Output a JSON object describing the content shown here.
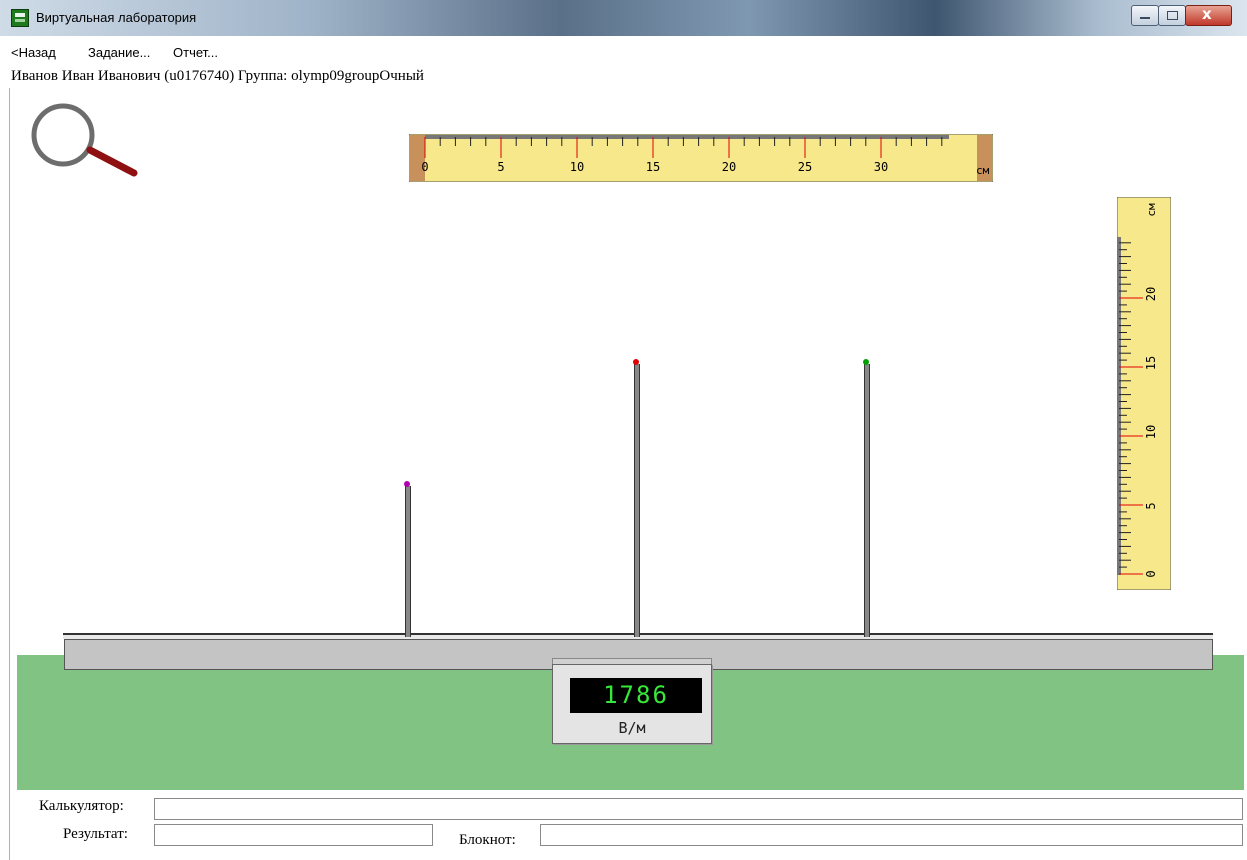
{
  "window": {
    "title": "Виртуальная лаборатория",
    "buttons": {
      "minimize": "minimize",
      "maximize": "maximize",
      "close": "x"
    }
  },
  "menu": {
    "back": "<Назад",
    "task": "Задание...",
    "report": "Отчет..."
  },
  "user": {
    "line": "Иванов Иван Иванович (u0176740)  Группа: olymp09groupОчный"
  },
  "magnifier": {
    "icon": "magnifier-icon"
  },
  "ruler_horizontal": {
    "unit": "см",
    "labels": [
      "0",
      "5",
      "10",
      "15",
      "20",
      "25",
      "30"
    ]
  },
  "ruler_vertical": {
    "unit": "см",
    "labels": [
      "0",
      "5",
      "10",
      "15",
      "20"
    ]
  },
  "rods": [
    {
      "name": "rod-left",
      "tip_color": "#b000b0"
    },
    {
      "name": "rod-middle",
      "tip_color": "#e00000"
    },
    {
      "name": "rod-right",
      "tip_color": "#00a000"
    }
  ],
  "meter": {
    "value": "1786",
    "unit": "В/м"
  },
  "form": {
    "calculator_label": "Калькулятор:",
    "result_label": "Результат:",
    "notepad_label": "Блокнот:",
    "calculator_value": "",
    "result_value": "",
    "notepad_value": ""
  },
  "colors": {
    "ground": "#80c382",
    "ruler": "#f7e98b",
    "ruler_end": "#c8905a",
    "display_text": "#36e83a"
  }
}
